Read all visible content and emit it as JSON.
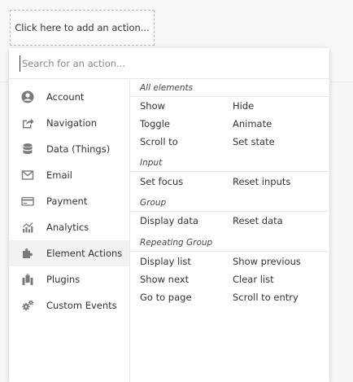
{
  "trigger": {
    "label": "Click here to add an action..."
  },
  "search": {
    "placeholder": "Search for an action..."
  },
  "sidebar": {
    "items": [
      {
        "label": "Account",
        "icon": "account-icon"
      },
      {
        "label": "Navigation",
        "icon": "navigation-icon"
      },
      {
        "label": "Data (Things)",
        "icon": "database-icon"
      },
      {
        "label": "Email",
        "icon": "email-icon"
      },
      {
        "label": "Payment",
        "icon": "payment-card-icon"
      },
      {
        "label": "Analytics",
        "icon": "analytics-icon"
      },
      {
        "label": "Element Actions",
        "icon": "puzzle-icon",
        "selected": true
      },
      {
        "label": "Plugins",
        "icon": "plugins-icon"
      },
      {
        "label": "Custom Events",
        "icon": "gears-icon"
      }
    ]
  },
  "groups": [
    {
      "title": "All elements",
      "actions": [
        "Show",
        "Hide",
        "Toggle",
        "Animate",
        "Scroll to",
        "Set state"
      ]
    },
    {
      "title": "Input",
      "actions": [
        "Set focus",
        "Reset inputs"
      ]
    },
    {
      "title": "Group",
      "actions": [
        "Display data",
        "Reset data"
      ]
    },
    {
      "title": "Repeating Group",
      "actions": [
        "Display list",
        "Show previous",
        "Show next",
        "Clear list",
        "Go to page",
        "Scroll to entry"
      ]
    }
  ],
  "colors": {
    "icon": "#7a7a7a",
    "selected_bg": "#f2f2f2",
    "divider": "#e8e8e8"
  }
}
